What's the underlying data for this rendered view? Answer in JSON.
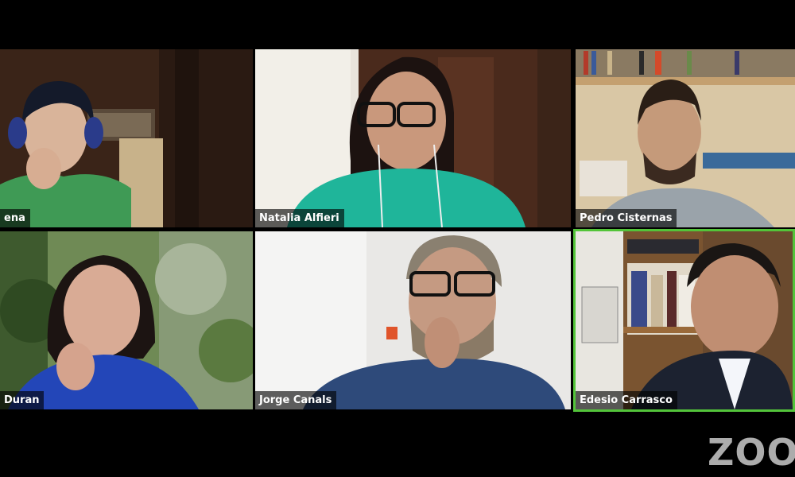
{
  "participants": [
    {
      "name": "ena"
    },
    {
      "name": "Natalia Alfieri"
    },
    {
      "name": "Pedro Cisternas"
    },
    {
      "name": "Duran"
    },
    {
      "name": "Jorge Canals"
    },
    {
      "name": "Edesio Carrasco"
    }
  ],
  "active_speaker_index": 5,
  "branding": {
    "watermark": "ZOO"
  },
  "colors": {
    "background": "#000000",
    "active_speaker_border": "#53c43a",
    "label_bg": "rgba(0,0,0,0.62)"
  }
}
